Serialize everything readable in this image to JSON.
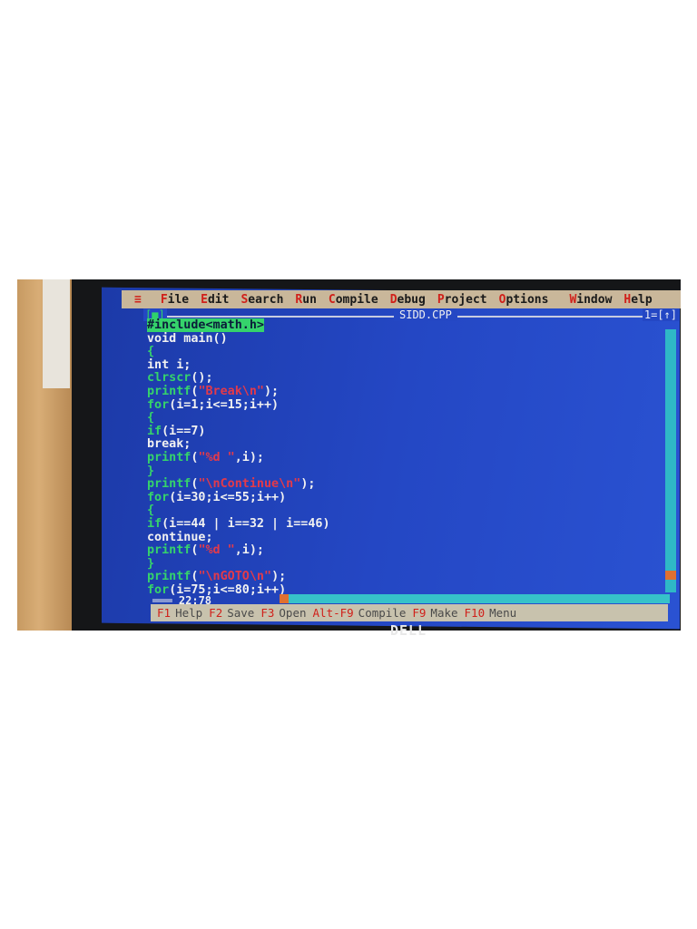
{
  "menu": {
    "system_icon": "≡",
    "items": [
      {
        "hot": "F",
        "rest": "ile"
      },
      {
        "hot": "E",
        "rest": "dit"
      },
      {
        "hot": "S",
        "rest": "earch"
      },
      {
        "hot": "R",
        "rest": "un"
      },
      {
        "hot": "C",
        "rest": "ompile"
      },
      {
        "hot": "D",
        "rest": "ebug"
      },
      {
        "hot": "P",
        "rest": "roject"
      },
      {
        "hot": "O",
        "rest": "ptions"
      },
      {
        "hot": "W",
        "rest": "indow"
      },
      {
        "hot": "H",
        "rest": "elp"
      }
    ]
  },
  "window": {
    "close_box": "[■]",
    "filename": "SIDD.CPP",
    "number_box": "1=[↑]"
  },
  "code_lines": [
    "#include<math.h>",
    "void main()",
    "{",
    "int i;",
    "clrscr();",
    "printf(\"Break\\n\");",
    "for(i=1;i<=15;i++)",
    "{",
    "if(i==7)",
    "break;",
    "printf(\"%d \",i);",
    "}",
    "printf(\"\\nContinue\\n\");",
    "for(i=30;i<=55;i++)",
    "{",
    "if(i==44 | i==32 | i==46)",
    "continue;",
    "printf(\"%d \",i);",
    "}",
    "printf(\"\\nGOTO\\n\");",
    "for(i=75;i<=80;i++)"
  ],
  "status": {
    "position": "22:78"
  },
  "function_keys": [
    {
      "key": "F1",
      "label": "Help"
    },
    {
      "key": "F2",
      "label": "Save"
    },
    {
      "key": "F3",
      "label": "Open"
    },
    {
      "key": "Alt-F9",
      "label": "Compile"
    },
    {
      "key": "F9",
      "label": "Make"
    },
    {
      "key": "F10",
      "label": "Menu"
    }
  ],
  "monitor_brand": "DELL",
  "colors": {
    "screen_blue": "#2447c4",
    "menu_bg": "#c9b79a",
    "hotkey_red": "#d0201a",
    "code_green": "#35d36b",
    "string_red": "#e33a4a",
    "code_white": "#f1f1f1"
  }
}
